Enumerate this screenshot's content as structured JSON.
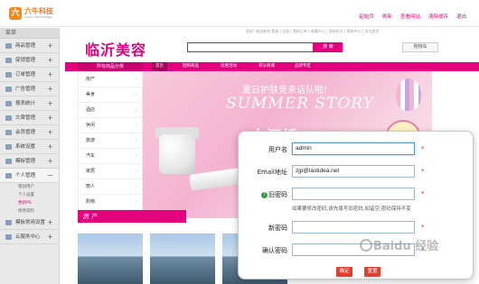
{
  "logo": {
    "mark": "六",
    "name": "六牛科技",
    "sub": "Liuniu Technology"
  },
  "topnav": [
    "起始页",
    "刷新",
    "查看网站",
    "清除缓存",
    "退出"
  ],
  "sidebar": {
    "title": "菜单",
    "items": [
      {
        "label": "商品管理"
      },
      {
        "label": "促销管理"
      },
      {
        "label": "订单管理"
      },
      {
        "label": "广告管理"
      },
      {
        "label": "报表统计"
      },
      {
        "label": "文章管理"
      },
      {
        "label": "会员管理"
      },
      {
        "label": "系统设置"
      },
      {
        "label": "模板管理"
      },
      {
        "label": "个人管理"
      }
    ],
    "subitems": [
      "增加用户",
      "个人设置",
      "更新PS",
      "修改资料"
    ],
    "items_bottom": [
      {
        "label": "模板常用设置"
      },
      {
        "label": "云服务中心"
      }
    ]
  },
  "site": {
    "top_links": "您好! 欢迎来到  登录 | 注册 | 我的订单 | 收藏中心 | 我的积分 | 帮助中心 | 设为首页",
    "brand": "临沂美容",
    "search_button": "搜 索",
    "cart_button": "购物车",
    "catalog_title": "所有商品分类",
    "menu": [
      "首页",
      "团购商品",
      "优惠活动",
      "积分商城",
      "品牌专区"
    ],
    "categories": [
      "房产",
      "美食",
      "酒店",
      "休闲",
      "旅游",
      "汽车",
      "家居",
      "丽人",
      "购物"
    ],
    "banner": {
      "line1": "夏日护肤竞来话队啦!",
      "line2": "SUMMER STORY",
      "line3": "女汉纸"
    },
    "section_title": "房 产"
  },
  "form": {
    "username": {
      "label": "用户名",
      "value": "admin"
    },
    "email": {
      "label": "Email地址",
      "value": "zjp@lastidea.net"
    },
    "old_password": {
      "label": "旧密码",
      "value": ""
    },
    "hint": "如果要修改密码,请先填写旧密码,如留空,密码保持不变",
    "new_password": {
      "label": "新密码",
      "value": ""
    },
    "confirm_password": {
      "label": "确认密码",
      "value": ""
    },
    "required_mark": "*",
    "confirm_button": "确定",
    "reset_button": "重置"
  },
  "watermark": "Baidu 经验"
}
